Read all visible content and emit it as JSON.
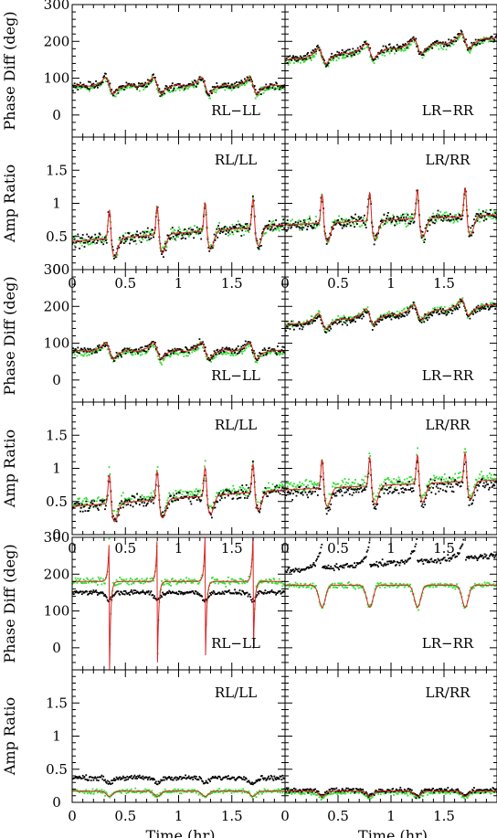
{
  "chart_data": {
    "type": "scatter",
    "x_axis": {
      "label": "Time (hr)",
      "range": [
        0,
        2
      ],
      "ticks": [
        "0",
        "0.5",
        "1",
        "1.5"
      ]
    },
    "phase_axis": {
      "label": "Phase Diff (deg)",
      "range": [
        -60,
        300
      ],
      "ticks": [
        "0",
        "100",
        "200",
        "300"
      ]
    },
    "amp_axis": {
      "label": "Amp Ratio",
      "range": [
        0,
        2
      ],
      "ticks": [
        "0",
        "0.5",
        "1",
        "1.5"
      ]
    },
    "colors": {
      "black_series": "#000000",
      "green_series": "#33dd33",
      "model_curve": "#dd2222"
    },
    "scan_times_hr": [
      0.35,
      0.8,
      1.25,
      1.7
    ],
    "groups": [
      {
        "id": "top",
        "panels": [
          {
            "kind": "phase",
            "label": "RL−LL",
            "label_pos": "bottom-right",
            "levels": {
              "black": 80,
              "green": 75,
              "model": 80
            },
            "swing": 45
          },
          {
            "kind": "phase",
            "label": "LR−RR",
            "label_pos": "bottom-right",
            "levels": {
              "black": 150,
              "green": 145,
              "model": 150
            },
            "swing": 45,
            "trend": 60
          },
          {
            "kind": "amp",
            "label": "RL/LL",
            "label_pos": "top-right",
            "levels": {
              "black": 0.55,
              "green": 0.55,
              "model": 0.55
            },
            "trend": 0.25
          },
          {
            "kind": "amp",
            "label": "LR/RR",
            "label_pos": "top-right",
            "levels": {
              "black": 0.75,
              "green": 0.75,
              "model": 0.75
            },
            "trend": 0.15
          }
        ]
      },
      {
        "id": "middle",
        "panels": [
          {
            "kind": "phase",
            "label": "RL−LL",
            "label_pos": "bottom-right",
            "levels": {
              "black": 80,
              "green": 75,
              "model": 80
            },
            "swing": 45
          },
          {
            "kind": "phase",
            "label": "LR−RR",
            "label_pos": "bottom-right",
            "levels": {
              "black": 145,
              "green": 150,
              "model": 150
            },
            "swing": 45,
            "trend": 55
          },
          {
            "kind": "amp",
            "label": "RL/LL",
            "label_pos": "top-right",
            "levels": {
              "black": 0.55,
              "green": 0.6,
              "model": 0.55
            },
            "trend": 0.25
          },
          {
            "kind": "amp",
            "label": "LR/RR",
            "label_pos": "top-right",
            "levels": {
              "black": 0.7,
              "green": 0.8,
              "model": 0.75
            },
            "trend": 0.15
          }
        ]
      },
      {
        "id": "bottom",
        "panels": [
          {
            "kind": "phase",
            "label": "RL−LL",
            "label_pos": "bottom-right",
            "levels": {
              "black": 150,
              "green": 180,
              "model": 180
            },
            "wrap": true
          },
          {
            "kind": "phase",
            "label": "LR−RR",
            "label_pos": "bottom-right",
            "levels": {
              "black": 210,
              "green": 170,
              "model": 170
            },
            "trend": 40
          },
          {
            "kind": "amp",
            "label": "RL/LL",
            "label_pos": "top-right",
            "levels": {
              "black": 0.37,
              "green": 0.17,
              "model": 0.17
            }
          },
          {
            "kind": "amp",
            "label": "LR/RR",
            "label_pos": "top-right",
            "levels": {
              "black": 0.18,
              "green": 0.15,
              "model": 0.17
            }
          }
        ]
      }
    ]
  }
}
